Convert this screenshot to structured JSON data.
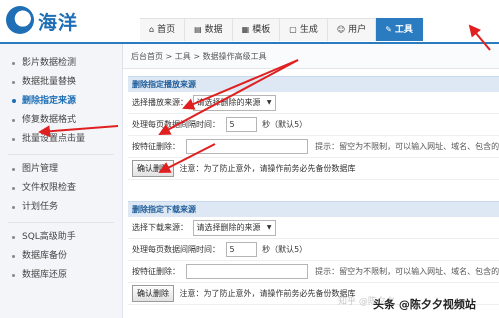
{
  "brand": {
    "name": "海洋"
  },
  "topnav": [
    {
      "icon": "⌂",
      "label": "首页"
    },
    {
      "icon": "▤",
      "label": "数据"
    },
    {
      "icon": "▦",
      "label": "模板"
    },
    {
      "icon": "▢",
      "label": "生成"
    },
    {
      "icon": "☺",
      "label": "用户"
    },
    {
      "icon": "✎",
      "label": "工具"
    }
  ],
  "sidebar": {
    "group1": [
      "影片数据检测",
      "数据批量替换",
      "删除指定来源",
      "修复数据格式",
      "批量设置点击量"
    ],
    "group2": [
      "图片管理",
      "文件权限检查",
      "计划任务"
    ],
    "group3": [
      "SQL高级助手",
      "数据库备份",
      "数据库还原"
    ]
  },
  "breadcrumb": "后台首页 > 工具 > 数据操作高级工具",
  "panel1": {
    "title": "删除指定播放来源",
    "select_label": "选择播放来源：",
    "select_value": "请选择删除的来源",
    "interval_label": "处理每页数据间隔时间：",
    "interval_value": "5",
    "interval_suffix": "秒（默认5）",
    "feature_label": "按特征删除：",
    "feature_hint": "提示：留空为不限制，可以输入网址、域名、包含的字符",
    "confirm_button": "确认删除",
    "notice": "注意：为了防止意外，请操作前务必先备份数据库"
  },
  "panel2": {
    "title": "删除指定下载来源",
    "select_label": "选择下载来源：",
    "select_value": "请选择删除的来源",
    "interval_label": "处理每页数据间隔时间：",
    "interval_value": "5",
    "interval_suffix": "秒（默认5）",
    "feature_label": "按特征删除：",
    "feature_hint": "提示：留空为不限制，可以输入网址、域名、包含的字符",
    "confirm_button": "确认删除",
    "notice": "注意：为了防止意外，请操作前务必先备份数据库"
  },
  "watermark": {
    "zhihu": "知乎 @陈夕夕",
    "toutiao": "头条 @陈夕夕视频站"
  },
  "colors": {
    "accent": "#2a7bc0",
    "arrow": "#e02020"
  }
}
